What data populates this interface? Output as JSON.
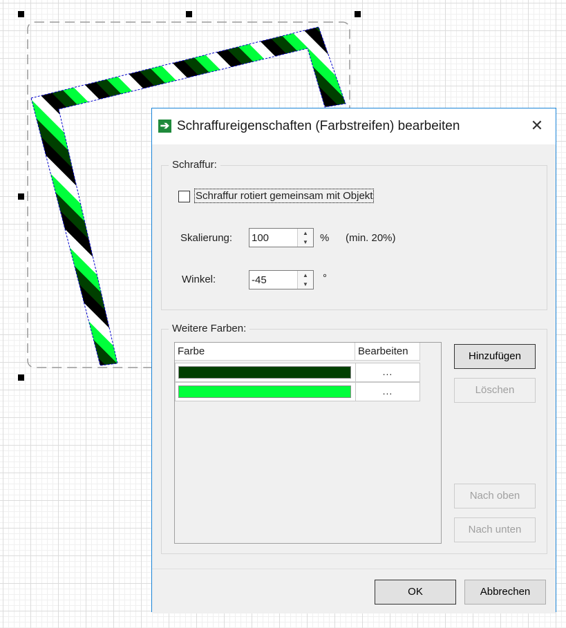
{
  "dialog": {
    "title": "Schraffureigenschaften (Farbstreifen) bearbeiten",
    "close_glyph": "✕",
    "title_icon_glyph": "➔",
    "hatch_group": {
      "title": "Schraffur:",
      "rotate_checkbox_label": "Schraffur rotiert gemeinsam mit Objekt",
      "rotate_checked": false,
      "scale_label": "Skalierung:",
      "scale_value": "100",
      "scale_unit": "%",
      "scale_hint": "(min. 20%)",
      "angle_label": "Winkel:",
      "angle_value": "-45",
      "angle_unit": "°"
    },
    "colors_group": {
      "title": "Weitere Farben:",
      "columns": [
        "Farbe",
        "Bearbeiten"
      ],
      "rows": [
        {
          "color": "#003f00",
          "edit_label": "..."
        },
        {
          "color": "#00ff3b",
          "edit_label": "..."
        }
      ],
      "add_button": "Hinzufügen",
      "delete_button": "Löschen",
      "up_button": "Nach oben",
      "down_button": "Nach unten"
    },
    "ok_button": "OK",
    "cancel_button": "Abbrechen"
  },
  "colors": {
    "stripe_dark": "#003f00",
    "stripe_green": "#00ff3b",
    "stripe_black": "#000000",
    "stripe_white": "#ffffff",
    "accent_border": "#1883d7"
  }
}
